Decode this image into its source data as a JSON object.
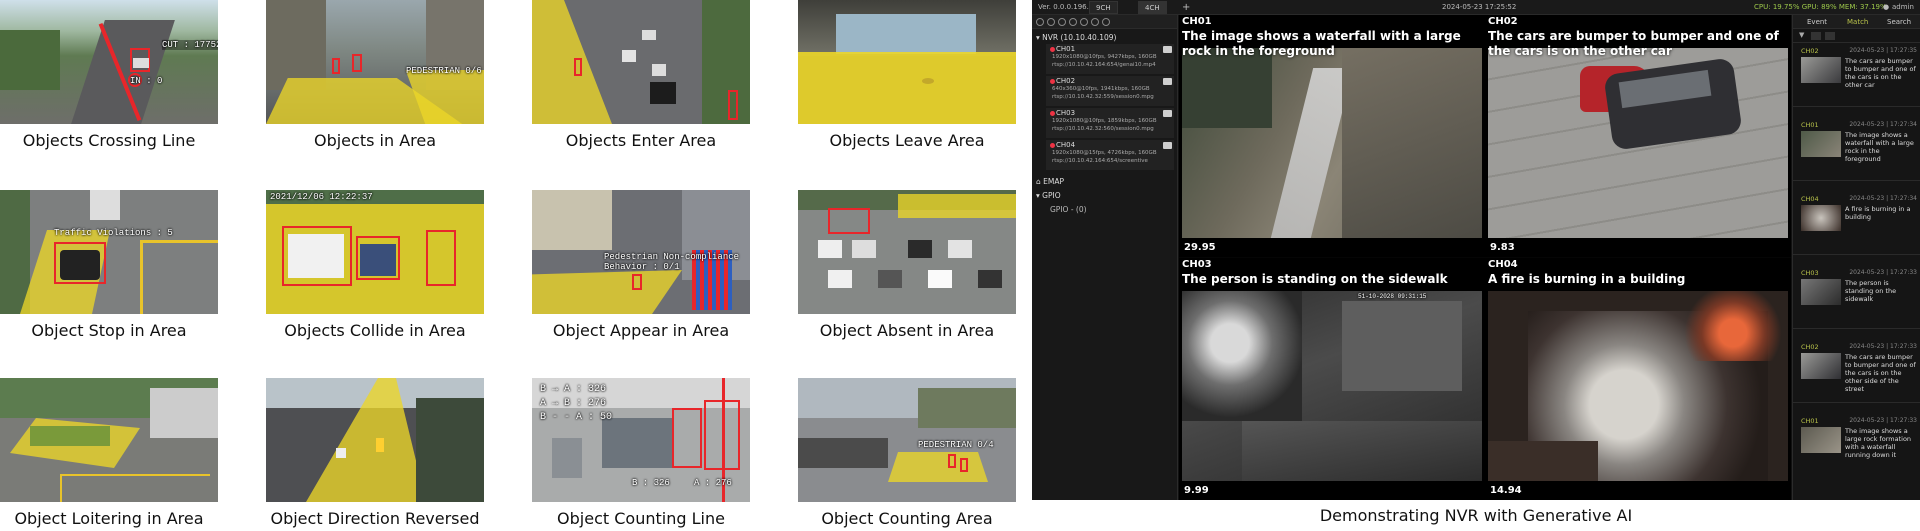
{
  "demos": [
    {
      "caption": "Objects Crossing Line",
      "overlays": [
        "CUT : 17752",
        "IN : 0"
      ]
    },
    {
      "caption": "Objects in Area",
      "overlays": [
        "PEDESTRIAN 0/6"
      ]
    },
    {
      "caption": "Objects Enter Area",
      "overlays": []
    },
    {
      "caption": "Objects Leave Area",
      "overlays": []
    },
    {
      "caption": "Object Stop in Area",
      "overlays": [
        "Traffic Violations : 5"
      ]
    },
    {
      "caption": "Objects Collide in Area",
      "overlays": [
        "2021/12/06 12:22:37"
      ]
    },
    {
      "caption": "Object Appear in Area",
      "overlays": [
        "Pedestrian Non-compliance",
        "Behavior : 0/1"
      ]
    },
    {
      "caption": "Object Absent in Area",
      "overlays": []
    },
    {
      "caption": "Object Loitering in Area",
      "overlays": []
    },
    {
      "caption": "Object Direction Reversed",
      "overlays": []
    },
    {
      "caption": "Object Counting Line",
      "overlays": [
        "B → A : 326",
        "A → B : 276",
        "B - - A : 50",
        "B : 326",
        "A : 276"
      ]
    },
    {
      "caption": "Object Counting Area",
      "overlays": [
        "PEDESTRIAN 0/4"
      ]
    }
  ],
  "nvr": {
    "caption": "Demonstrating NVR with Generative AI",
    "titlebar": {
      "version": "Ver. 0.0.0.196.2",
      "tabs": [
        "9CH",
        "4CH"
      ],
      "add_tab": "+",
      "datetime": "2024-05-23 17:25:52",
      "stats": "CPU: 19.75% GPU: 89% MEM: 37.19%",
      "user": "admin"
    },
    "tree": {
      "nvr_label": "NVR (10.10.40.109)",
      "channels": [
        {
          "name": "CH01",
          "spec": "1920x1080@10fps, 9427kbps, 160GB",
          "url": "rtsp://10.10.42.164:654/genai10.mp4"
        },
        {
          "name": "CH02",
          "spec": "640x360@10fps, 1941kbps, 160GB",
          "url": "rtsp://10.10.42.32:559/session0.mpg"
        },
        {
          "name": "CH03",
          "spec": "1920x1080@10fps, 1859kbps, 160GB",
          "url": "rtsp://10.10.42.32:560/session0.mpg"
        },
        {
          "name": "CH04",
          "spec": "1920x1080@15fps, 4726kbps, 160GB",
          "url": "rtsp://10.10.42.164:654/screentive"
        }
      ],
      "emap": "EMAP",
      "gpio": "GPIO",
      "gpio_item": "GPIO - (0)"
    },
    "cells": [
      {
        "ch": "CH01",
        "caption": "The image shows a waterfall with a large rock in the foreground",
        "fps": "29.95"
      },
      {
        "ch": "CH02",
        "caption": "The cars are bumper to bumper and one of the cars is on the other car",
        "fps": "9.83"
      },
      {
        "ch": "CH03",
        "caption": "The person is standing on the sidewalk",
        "fps": "9.99",
        "timestamp": "51-10-2028 09:31:15"
      },
      {
        "ch": "CH04",
        "caption": "A fire is burning in a building",
        "fps": "14.94"
      }
    ],
    "events_panel": {
      "tabs": [
        "Event",
        "Match",
        "Search"
      ],
      "events": [
        {
          "ch": "CH02",
          "time": "2024-05-23 | 17:27:35",
          "text": "The cars are bumper to bumper and one of the cars is on the other car"
        },
        {
          "ch": "CH01",
          "time": "2024-05-23 | 17:27:34",
          "text": "The image shows a waterfall with a large rock in the foreground"
        },
        {
          "ch": "CH04",
          "time": "2024-05-23 | 17:27:34",
          "text": "A fire is burning in a building"
        },
        {
          "ch": "CH03",
          "time": "2024-05-23 | 17:27:33",
          "text": "The person is standing on the sidewalk"
        },
        {
          "ch": "CH02",
          "time": "2024-05-23 | 17:27:33",
          "text": "The cars are bumper to bumper and one of the cars is on the other side of the street"
        },
        {
          "ch": "CH01",
          "time": "2024-05-23 | 17:27:33",
          "text": "The image shows a large rock formation with a waterfall running down it"
        }
      ]
    }
  }
}
